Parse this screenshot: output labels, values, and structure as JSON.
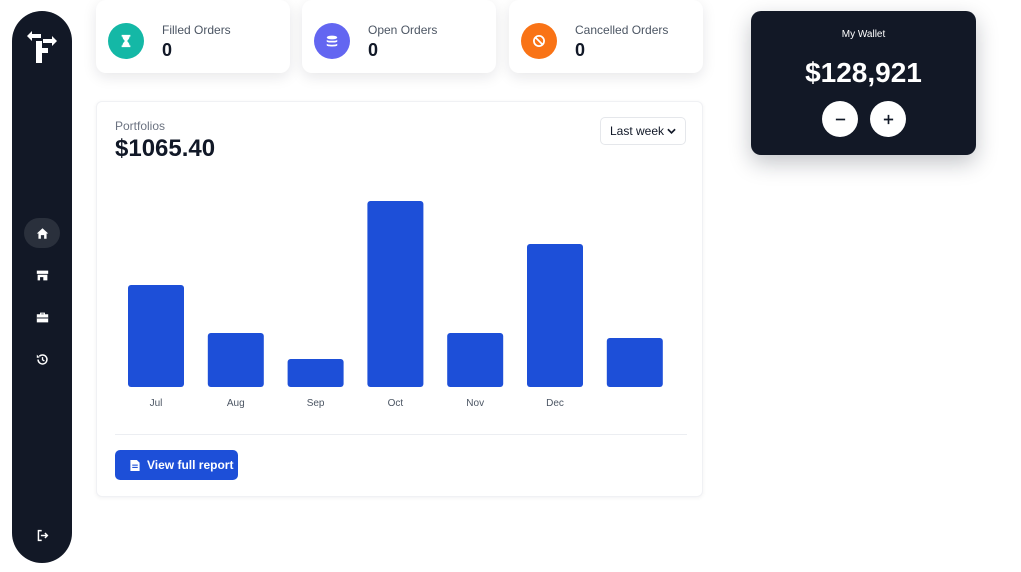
{
  "sidebar": {
    "nav": [
      {
        "name": "home-icon",
        "active": true
      },
      {
        "name": "store-icon",
        "active": false
      },
      {
        "name": "briefcase-icon",
        "active": false
      },
      {
        "name": "history-icon",
        "active": false
      }
    ],
    "logout_icon": "logout-icon"
  },
  "stats": [
    {
      "label": "Filled Orders",
      "value": "0",
      "color": "#14b8a6",
      "icon": "hourglass-icon"
    },
    {
      "label": "Open Orders",
      "value": "0",
      "color": "#6366f1",
      "icon": "coins-icon"
    },
    {
      "label": "Cancelled Orders",
      "value": "0",
      "color": "#f97316",
      "icon": "ban-icon"
    }
  ],
  "portfolio": {
    "label": "Portfolios",
    "value": "$1065.40",
    "period": "Last week",
    "report_button": "View full report"
  },
  "chart_data": {
    "type": "bar",
    "categories": [
      "Jul",
      "Aug",
      "Sep",
      "Oct",
      "Nov",
      "Dec",
      ""
    ],
    "values": [
      102,
      54,
      28,
      186,
      54,
      143,
      49
    ],
    "ylim": [
      0,
      200
    ],
    "grid": false,
    "bar_color": "#1d4fd8"
  },
  "wallet": {
    "title": "My Wallet",
    "amount": "$128,921"
  },
  "colors": {
    "sidebar": "#121826",
    "accent": "#1d4fd8"
  }
}
